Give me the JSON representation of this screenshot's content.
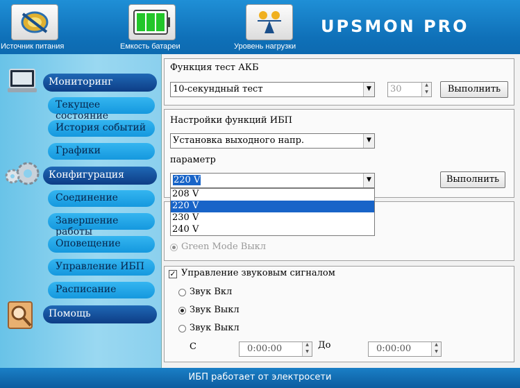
{
  "header": {
    "buttons": [
      {
        "label": "Источник питания",
        "icon": "power-source-icon"
      },
      {
        "label": "Емкость батареи",
        "icon": "battery-icon"
      },
      {
        "label": "Уровень нагрузки",
        "icon": "load-level-icon"
      }
    ],
    "logo": "UPSMON PRO"
  },
  "sidebar": {
    "monitoring": "Мониторинг",
    "monitoring_items": [
      "Текущее состояние",
      "История событий",
      "Графики"
    ],
    "configuration": "Конфигурация",
    "configuration_items": [
      "Соединение",
      "Завершение работы",
      "Оповещение",
      "Управление ИБП",
      "Расписание"
    ],
    "help": "Помощь"
  },
  "battery_test": {
    "title": "Функция тест АКБ",
    "selected": "10-секундный тест",
    "minutes": "30",
    "run_label": "Выполнить"
  },
  "ups_settings": {
    "title": "Настройки функций ИБП",
    "selected": "Установка выходного напр.",
    "param_label": "параметр",
    "param_value": "220 V",
    "run_label": "Выполнить",
    "options": [
      "208 V",
      "220 V",
      "230 V",
      "240 V"
    ],
    "selected_option_index": 1
  },
  "green_mode": {
    "off_label": "Green Mode Выкл"
  },
  "sound": {
    "title": "Управление звуковым сигналом",
    "checked": true,
    "on_label": "Звук Вкл",
    "off_label": "Звук Выкл",
    "scheduled_label": "Звук Выкл",
    "selected": "off",
    "from_label": "С",
    "to_label": "До",
    "from_time": "0:00:00",
    "to_time": "0:00:00"
  },
  "status": {
    "text": "ИБП работает от электросети"
  },
  "colors": {
    "header": "#1f8fd6",
    "nav_main": "#0d3d86",
    "nav_sub": "#1598de",
    "selection": "#1864c8"
  }
}
